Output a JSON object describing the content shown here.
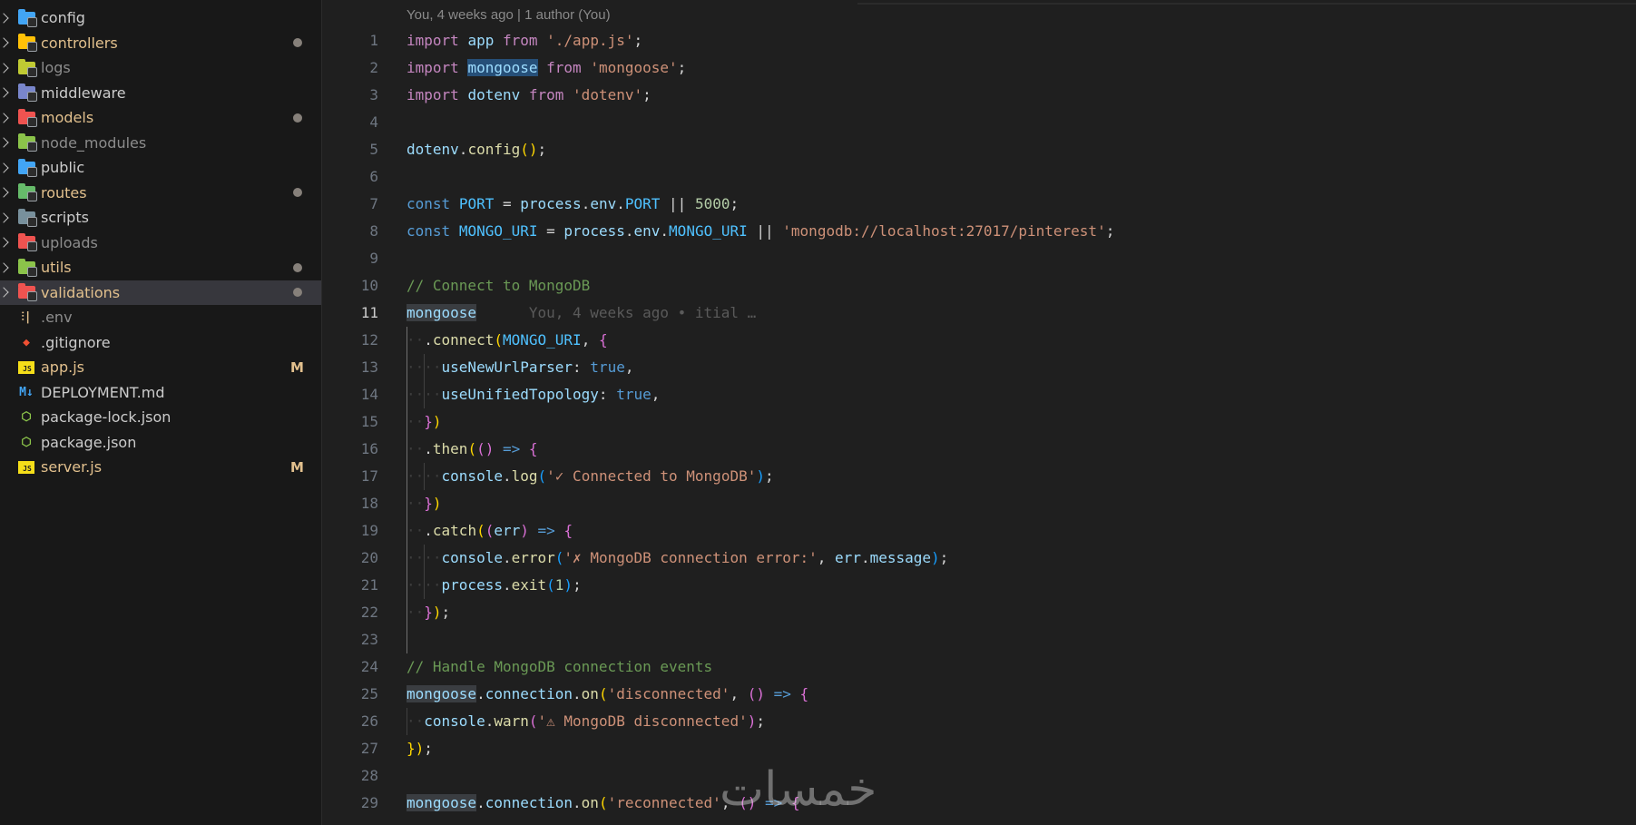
{
  "explorer": {
    "items": [
      {
        "label": "config",
        "kind": "folder",
        "icon": "config-folder-icon",
        "color": "#42a5f5",
        "state": ""
      },
      {
        "label": "controllers",
        "kind": "folder",
        "icon": "controllers-folder-icon",
        "color": "#ffc107",
        "state": "mod-dot"
      },
      {
        "label": "logs",
        "kind": "folder",
        "icon": "logs-folder-icon",
        "color": "#c0ca33",
        "state": "dim"
      },
      {
        "label": "middleware",
        "kind": "folder",
        "icon": "middleware-folder-icon",
        "color": "#7986cb",
        "state": ""
      },
      {
        "label": "models",
        "kind": "folder",
        "icon": "models-folder-icon",
        "color": "#ef5350",
        "state": "mod-dot"
      },
      {
        "label": "node_modules",
        "kind": "folder",
        "icon": "node-modules-folder-icon",
        "color": "#8bc34a",
        "state": "dim"
      },
      {
        "label": "public",
        "kind": "folder",
        "icon": "public-folder-icon",
        "color": "#42a5f5",
        "state": ""
      },
      {
        "label": "routes",
        "kind": "folder",
        "icon": "routes-folder-icon",
        "color": "#66bb6a",
        "state": "mod-dot"
      },
      {
        "label": "scripts",
        "kind": "folder",
        "icon": "scripts-folder-icon",
        "color": "#78909c",
        "state": ""
      },
      {
        "label": "uploads",
        "kind": "folder",
        "icon": "uploads-folder-icon",
        "color": "#ef5350",
        "state": "dim"
      },
      {
        "label": "utils",
        "kind": "folder",
        "icon": "utils-folder-icon",
        "color": "#8bc34a",
        "state": "mod-dot"
      },
      {
        "label": "validations",
        "kind": "folder",
        "icon": "validations-folder-icon",
        "color": "#ef5350",
        "state": "mod-dot"
      },
      {
        "label": ".env",
        "kind": "file",
        "icon": "env-file-icon",
        "glyph": "⫶|",
        "color": "#e2c08d",
        "state": "dim"
      },
      {
        "label": ".gitignore",
        "kind": "file",
        "icon": "git-icon",
        "glyph": "◆",
        "color": "#f05033",
        "state": ""
      },
      {
        "label": "app.js",
        "kind": "file",
        "icon": "javascript-file-icon",
        "glyph": "JS",
        "color": "#f5de19",
        "state": "mod-M"
      },
      {
        "label": "DEPLOYMENT.md",
        "kind": "file",
        "icon": "markdown-file-icon",
        "glyph": "M↓",
        "color": "#42a5f5",
        "state": ""
      },
      {
        "label": "package-lock.json",
        "kind": "file",
        "icon": "npm-package-icon",
        "glyph": "⬡",
        "color": "#8bc34a",
        "state": ""
      },
      {
        "label": "package.json",
        "kind": "file",
        "icon": "npm-package-icon",
        "glyph": "⬡",
        "color": "#8bc34a",
        "state": ""
      },
      {
        "label": "server.js",
        "kind": "file",
        "icon": "javascript-file-icon",
        "glyph": "JS",
        "color": "#f5de19",
        "state": "mod-M"
      }
    ],
    "selected_index": 11,
    "modified_badge": "M"
  },
  "editor": {
    "blame_header": "You, 4 weeks ago | 1 author (You)",
    "inline_blame": "You, 4 weeks ago • itial …",
    "active_line": 11,
    "lines": [
      {
        "n": "1"
      },
      {
        "n": "2"
      },
      {
        "n": "3"
      },
      {
        "n": "4"
      },
      {
        "n": "5"
      },
      {
        "n": "6"
      },
      {
        "n": "7"
      },
      {
        "n": "8"
      },
      {
        "n": "9"
      },
      {
        "n": "10"
      },
      {
        "n": "11"
      },
      {
        "n": "12"
      },
      {
        "n": "13"
      },
      {
        "n": "14"
      },
      {
        "n": "15"
      },
      {
        "n": "16"
      },
      {
        "n": "17"
      },
      {
        "n": "18"
      },
      {
        "n": "19"
      },
      {
        "n": "20"
      },
      {
        "n": "21"
      },
      {
        "n": "22"
      },
      {
        "n": "23"
      },
      {
        "n": "24"
      },
      {
        "n": "25"
      },
      {
        "n": "26"
      },
      {
        "n": "27"
      },
      {
        "n": "28"
      },
      {
        "n": "29"
      }
    ],
    "code": {
      "l1": [
        "import",
        " ",
        "app",
        " ",
        "from",
        " ",
        "'./app.js'",
        ";"
      ],
      "l2": [
        "import",
        " ",
        "mongoose",
        " ",
        "from",
        " ",
        "'mongoose'",
        ";"
      ],
      "l3": [
        "import",
        " ",
        "dotenv",
        " ",
        "from",
        " ",
        "'dotenv'",
        ";"
      ],
      "l5": [
        "dotenv",
        ".",
        "config",
        "(",
        ")",
        ";"
      ],
      "l7": [
        "const",
        " ",
        "PORT",
        " = ",
        "process",
        ".",
        "env",
        ".",
        "PORT",
        " || ",
        "5000",
        ";"
      ],
      "l8": [
        "const",
        " ",
        "MONGO_URI",
        " = ",
        "process",
        ".",
        "env",
        ".",
        "MONGO_URI",
        " || ",
        "'mongodb://localhost:27017/pinterest'",
        ";"
      ],
      "l10": [
        "// Connect to MongoDB"
      ],
      "l11": [
        "mongoose"
      ],
      "l12": [
        ".",
        "connect",
        "(",
        "MONGO_URI",
        ", ",
        "{"
      ],
      "l13": [
        "useNewUrlParser",
        ": ",
        "true",
        ","
      ],
      "l14": [
        "useUnifiedTopology",
        ": ",
        "true",
        ","
      ],
      "l15": [
        "}",
        ")"
      ],
      "l16": [
        ".",
        "then",
        "(",
        "(",
        ")",
        " ",
        "=>",
        " ",
        "{"
      ],
      "l17": [
        "console",
        ".",
        "log",
        "(",
        "'✓ Connected to MongoDB'",
        ")",
        ";"
      ],
      "l18": [
        "}",
        ")"
      ],
      "l19": [
        ".",
        "catch",
        "(",
        "(",
        "err",
        ")",
        " ",
        "=>",
        " ",
        "{"
      ],
      "l20": [
        "console",
        ".",
        "error",
        "(",
        "'✗ MongoDB connection error:'",
        ", ",
        "err",
        ".",
        "message",
        ")",
        ";"
      ],
      "l21": [
        "process",
        ".",
        "exit",
        "(",
        "1",
        ")",
        ";"
      ],
      "l22": [
        "}",
        ")",
        ";"
      ],
      "l24": [
        "// Handle MongoDB connection events"
      ],
      "l25": [
        "mongoose",
        ".",
        "connection",
        ".",
        "on",
        "(",
        "'disconnected'",
        ", ",
        "(",
        ")",
        " ",
        "=>",
        " ",
        "{"
      ],
      "l26": [
        "console",
        ".",
        "warn",
        "(",
        "'⚠ MongoDB disconnected'",
        ")",
        ";"
      ],
      "l27": [
        "}",
        ")",
        ";"
      ],
      "l29": [
        "mongoose",
        ".",
        "connection",
        ".",
        "on",
        "(",
        "'reconnected'",
        ", ",
        "(",
        ")",
        " ",
        "=>",
        " ",
        "{"
      ]
    }
  },
  "watermark": "خمسات"
}
